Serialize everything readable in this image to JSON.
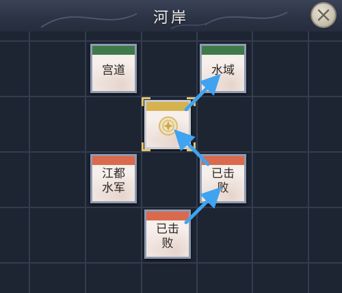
{
  "header": {
    "title": "河岸"
  },
  "tiles": {
    "gongdao": {
      "label": "宫道",
      "band_color": "#3f7a4a"
    },
    "shuiyu": {
      "label": "水域",
      "band_color": "#3f7a4a"
    },
    "jiangdu": {
      "label_line1": "江都",
      "label_line2": "水军",
      "band_color": "#d96a4d"
    },
    "defeated_right": {
      "label_line1": "已击",
      "label_line2": "败",
      "band_color": "#d96a4d"
    },
    "defeated_bottom": {
      "label_line1": "已击",
      "label_line2": "败",
      "band_color": "#d96a4d"
    },
    "current": {
      "band_color": "#d6b24f",
      "icon": "coin-star-icon"
    }
  },
  "colors": {
    "arrow": "#3fa3f0",
    "frame_corner": "#e1c46e"
  }
}
